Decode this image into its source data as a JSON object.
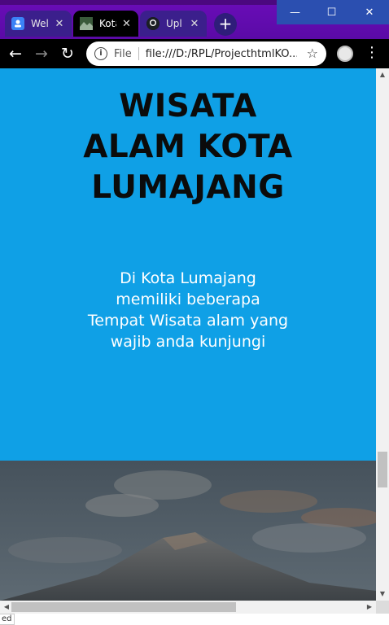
{
  "browser": {
    "tabs": [
      {
        "label": "Wel",
        "favicon_color": "#3b82f6",
        "active": false
      },
      {
        "label": "Kota",
        "favicon_color": "#3a5a3a",
        "active": true
      },
      {
        "label": "Upl",
        "favicon_color": "#1b1f23",
        "active": false
      }
    ],
    "new_tab_icon": "+",
    "window_controls": {
      "minimize": "—",
      "maximize": "☐",
      "close": "✕"
    },
    "toolbar": {
      "back_icon": "←",
      "forward_icon": "→",
      "reload_icon": "↻",
      "info_icon": "i",
      "scheme_label": "File",
      "url": "file:///D:/RPL/ProjecthtmlKO...",
      "star_icon": "☆",
      "menu_icon": "⋮"
    },
    "status_text": "ed"
  },
  "page": {
    "hero": {
      "title_lines": [
        "WISATA",
        "ALAM KOTA",
        "LUMAJANG"
      ],
      "description_lines": [
        "Di Kota Lumajang",
        "memiliki beberapa",
        "Tempat Wisata alam yang",
        "wajib anda kunjungi"
      ],
      "background": "#0fa0e6"
    }
  },
  "colors": {
    "accent_blue": "#0fa0e6",
    "titlebar_purple": "#6a0db8",
    "window_controls_blue": "#2b4fb0"
  }
}
